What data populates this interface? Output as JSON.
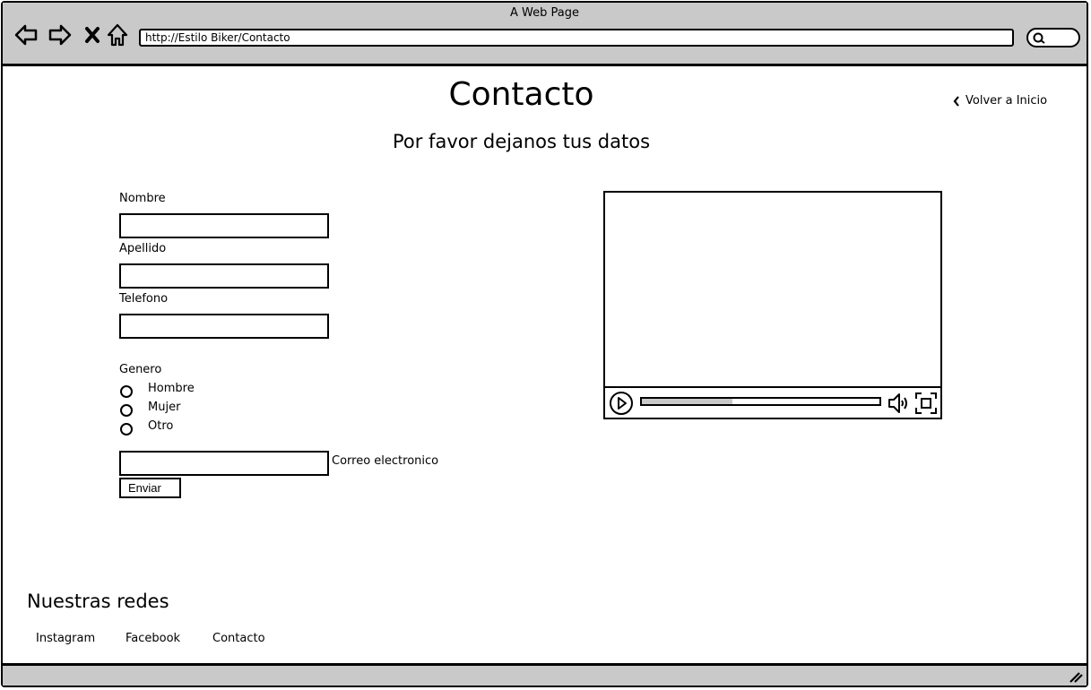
{
  "browser": {
    "window_title": "A Web Page",
    "url": "http://Estilo Biker/Contacto"
  },
  "page": {
    "title": "Contacto",
    "subtitle": "Por favor dejanos tus datos",
    "back_link": "Volver a Inicio"
  },
  "form": {
    "nombre_label": "Nombre",
    "nombre_value": "",
    "apellido_label": "Apellido",
    "apellido_value": "",
    "telefono_label": "Telefono",
    "telefono_value": "",
    "genero_label": "Genero",
    "genero_options": [
      "Hombre",
      "Mujer",
      "Otro"
    ],
    "correo_label": "Correo electronico",
    "correo_value": "",
    "submit_label": "Enviar"
  },
  "video": {
    "progress": 0.38
  },
  "footer": {
    "title": "Nuestras redes",
    "links": [
      "Instagram",
      "Facebook",
      "Contacto"
    ]
  },
  "colors": {
    "chrome": "#c9c9c9",
    "ink": "#000000"
  }
}
